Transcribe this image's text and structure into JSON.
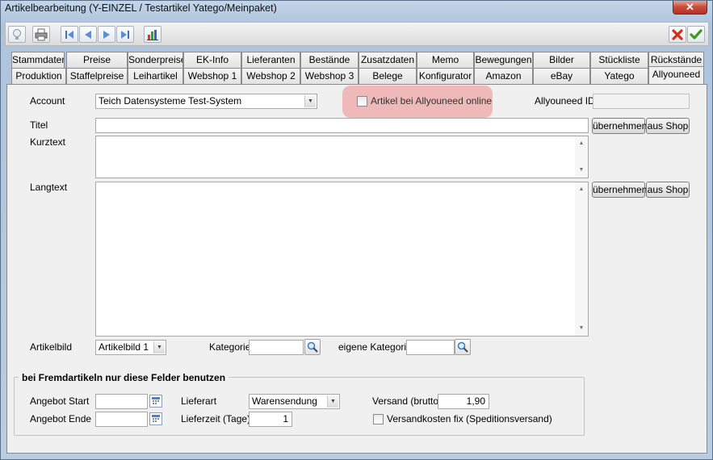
{
  "window": {
    "title": "Artikelbearbeitung (Y-EINZEL / Testartikel Yatego/Meinpaket)",
    "close_label": "✕"
  },
  "toolbar": {
    "icons": [
      "lightbulb-icon",
      "printer-icon",
      "first-record-icon",
      "previous-record-icon",
      "next-record-icon",
      "last-record-icon",
      "chart-icon",
      "cancel-icon",
      "confirm-icon"
    ]
  },
  "tabs": {
    "row1": [
      "Stammdaten",
      "Preise",
      "Sonderpreise",
      "EK-Info",
      "Lieferanten",
      "Bestände",
      "Zusatzdaten",
      "Memo",
      "Bewegungen",
      "Bilder",
      "Stückliste",
      "Rückstände"
    ],
    "row2": [
      "Produktion",
      "Staffelpreise",
      "Leihartikel",
      "Webshop 1",
      "Webshop 2",
      "Webshop 3",
      "Belege",
      "Konfigurator",
      "Amazon",
      "eBay",
      "Yatego",
      "Allyouneed"
    ],
    "active": "Allyouneed"
  },
  "form": {
    "account_label": "Account",
    "account_value": "Teich Datensysteme Test-System",
    "online_label": "Artikel bei Allyouneed online",
    "id_label": "Allyouneed ID",
    "id_value": "",
    "titel_label": "Titel",
    "titel_value": "",
    "kurztext_label": "Kurztext",
    "langtext_label": "Langtext",
    "uebernehmen": "übernehmen",
    "aus_shop": "aus Shop",
    "artikelbild_label": "Artikelbild",
    "artikelbild_value": "Artikelbild 1",
    "kategorie_label": "Kategorie",
    "eigene_kategorie_label": "eigene Kategorie"
  },
  "group": {
    "title": "bei Fremdartikeln nur diese Felder benutzen",
    "angebot_start_label": "Angebot Start",
    "angebot_ende_label": "Angebot Ende",
    "lieferart_label": "Lieferart",
    "lieferart_value": "Warensendung",
    "lieferzeit_label": "Lieferzeit (Tage)",
    "lieferzeit_value": "1",
    "versand_label": "Versand (brutto)",
    "versand_value": "1,90",
    "versandkosten_label": "Versandkosten fix  (Speditionsversand)"
  },
  "colors": {
    "highlight": "#eeafaf",
    "close": "#c8503e"
  }
}
